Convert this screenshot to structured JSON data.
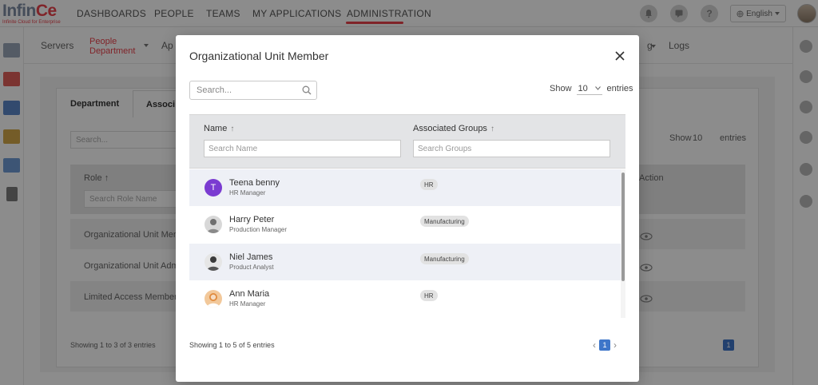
{
  "app": {
    "logo_text_a": "Infin",
    "logo_text_b": "Ce",
    "logo_tagline": "Infinite Cloud for Enterprise",
    "brand_color": "#e9424c"
  },
  "topnav": {
    "items": [
      "DASHBOARDS",
      "PEOPLE",
      "TEAMS",
      "MY APPLICATIONS",
      "ADMINISTRATION"
    ],
    "active": "ADMINISTRATION",
    "icons": [
      "bell-icon",
      "chat-icon",
      "help-icon"
    ],
    "help_glyph": "?",
    "language": "English"
  },
  "subnav": {
    "servers": "Servers",
    "people_department_1": "People",
    "people_department_2": "Department",
    "partial_ap": "Ap",
    "partial_g": "g",
    "logs": "Logs"
  },
  "background": {
    "tab_department": "Department",
    "tab_associated": "Associ",
    "search_placeholder": "Search...",
    "show_label": "Show",
    "show_value": "10",
    "entries_label": "entries",
    "role_header": "Role",
    "sort_glyph": "↑",
    "role_filter": "Search Role Name",
    "action_header": "Action",
    "rows": [
      "Organizational Unit Memb",
      "Organizational Unit Admi",
      "Limited Access Member"
    ],
    "footer": "Showing 1 to 3 of 3 entries",
    "page": "1"
  },
  "modal": {
    "title": "Organizational Unit Member",
    "search_placeholder": "Search...",
    "show_label": "Show",
    "show_value": "10",
    "entries_label": "entries",
    "columns": {
      "name": "Name",
      "groups": "Associated Groups",
      "sort_glyph": "↑"
    },
    "filters": {
      "name_placeholder": "Search Name",
      "groups_placeholder": "Search Groups"
    },
    "rows": [
      {
        "initial": "T",
        "name": "Teena benny",
        "role": "HR Manager",
        "group": "HR",
        "avatar_color": "#7a3bd1"
      },
      {
        "initial": "",
        "name": "Harry Peter",
        "role": "Production Manager",
        "group": "Manufacturing",
        "avatar_color": "#8a8a8a"
      },
      {
        "initial": "",
        "name": "Niel James",
        "role": "Product Analyst",
        "group": "Manufacturing",
        "avatar_color": "#555555"
      },
      {
        "initial": "",
        "name": "Ann Maria",
        "role": "HR Manager",
        "group": "HR",
        "avatar_color": "#e08a3c"
      }
    ],
    "footer": "Showing 1 to 5 of 5 entries",
    "page": "1",
    "prev_glyph": "‹",
    "next_glyph": "›",
    "accent_color": "#3e76c9"
  }
}
